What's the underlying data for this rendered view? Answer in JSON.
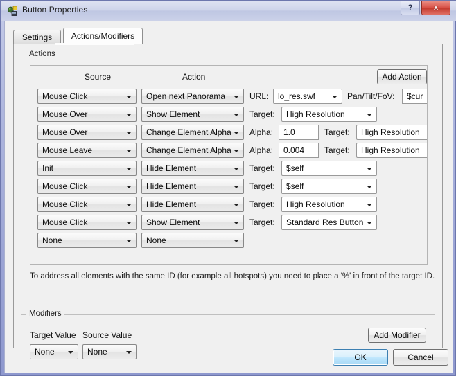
{
  "window": {
    "title": "Button Properties",
    "icon": "app-icon",
    "help_label": "?",
    "close_label": "x"
  },
  "tabs": [
    {
      "id": "settings",
      "label": "Settings",
      "selected": false
    },
    {
      "id": "actions-modifiers",
      "label": "Actions/Modifiers",
      "selected": true
    }
  ],
  "actions_group": {
    "title": "Actions",
    "add_button_label": "Add Action",
    "columns": {
      "source": "Source",
      "action": "Action"
    },
    "rows": [
      {
        "source": "Mouse Click",
        "action": "Open next Panorama",
        "label1": "URL:",
        "value1": "lo_res.swf",
        "value1_type": "combo",
        "label2": "Pan/Tilt/FoV:",
        "value2": "$cur",
        "value2_type": "textbox"
      },
      {
        "source": "Mouse Over",
        "action": "Show Element",
        "label1": "Target:",
        "value1": "High Resolution",
        "value1_type": "combo",
        "label2": "",
        "value2": "",
        "value2_type": "none"
      },
      {
        "source": "Mouse Over",
        "action": "Change Element Alpha",
        "label1": "Alpha:",
        "value1": "1.0",
        "value1_type": "textbox",
        "label2": "Target:",
        "value2": "High Resolution",
        "value2_type": "combo"
      },
      {
        "source": "Mouse Leave",
        "action": "Change Element Alpha",
        "label1": "Alpha:",
        "value1": "0.004",
        "value1_type": "textbox",
        "label2": "Target:",
        "value2": "High Resolution",
        "value2_type": "combo"
      },
      {
        "source": "Init",
        "action": "Hide Element",
        "label1": "Target:",
        "value1": "$self",
        "value1_type": "combo",
        "label2": "",
        "value2": "",
        "value2_type": "none"
      },
      {
        "source": "Mouse Click",
        "action": "Hide Element",
        "label1": "Target:",
        "value1": "$self",
        "value1_type": "combo",
        "label2": "",
        "value2": "",
        "value2_type": "none"
      },
      {
        "source": "Mouse Click",
        "action": "Hide Element",
        "label1": "Target:",
        "value1": "High Resolution",
        "value1_type": "combo",
        "label2": "",
        "value2": "",
        "value2_type": "none"
      },
      {
        "source": "Mouse Click",
        "action": "Show Element",
        "label1": "Target:",
        "value1": "Standard Res Button",
        "value1_type": "combo",
        "label2": "",
        "value2": "",
        "value2_type": "none"
      },
      {
        "source": "None",
        "action": "None",
        "label1": "",
        "value1": "",
        "value1_type": "none",
        "label2": "",
        "value2": "",
        "value2_type": "none"
      }
    ],
    "note": "To address all elements with the same ID (for example all hotspots) you need to place a '%' in front of the target ID."
  },
  "modifiers_group": {
    "title": "Modifiers",
    "add_button_label": "Add Modifier",
    "columns": {
      "target_value": "Target Value",
      "source_value": "Source Value"
    },
    "row": {
      "target_value": "None",
      "source_value": "None"
    }
  },
  "footer": {
    "ok_label": "OK",
    "cancel_label": "Cancel"
  },
  "colors": {
    "accent": "#3c7fb1",
    "close": "#c43a2e",
    "window_border": "#8e98ce",
    "client_bg": "#f0f0f0"
  }
}
